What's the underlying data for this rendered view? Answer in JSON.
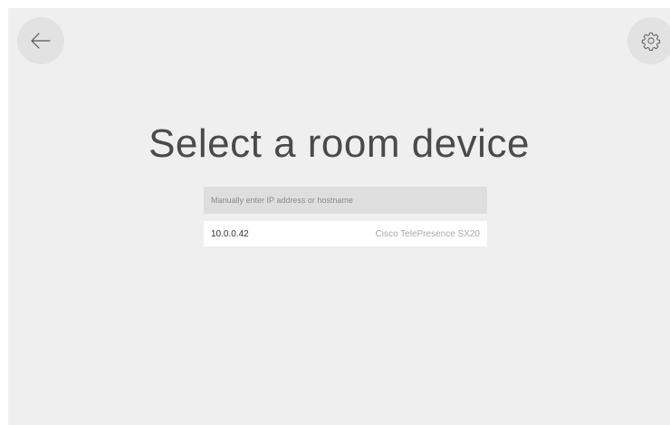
{
  "header": {
    "back_icon": "arrow-left-icon",
    "settings_icon": "gear-icon"
  },
  "main": {
    "title": "Select a room device",
    "manual_entry": {
      "value": "",
      "placeholder": "Manually enter IP address or hostname"
    },
    "devices": [
      {
        "ip": "10.0.0.42",
        "model": "Cisco TelePresence SX20"
      }
    ]
  },
  "colors": {
    "background": "#efefef",
    "button_bg": "#e2e2e2",
    "input_bg": "#dedede",
    "row_bg": "#ffffff"
  }
}
